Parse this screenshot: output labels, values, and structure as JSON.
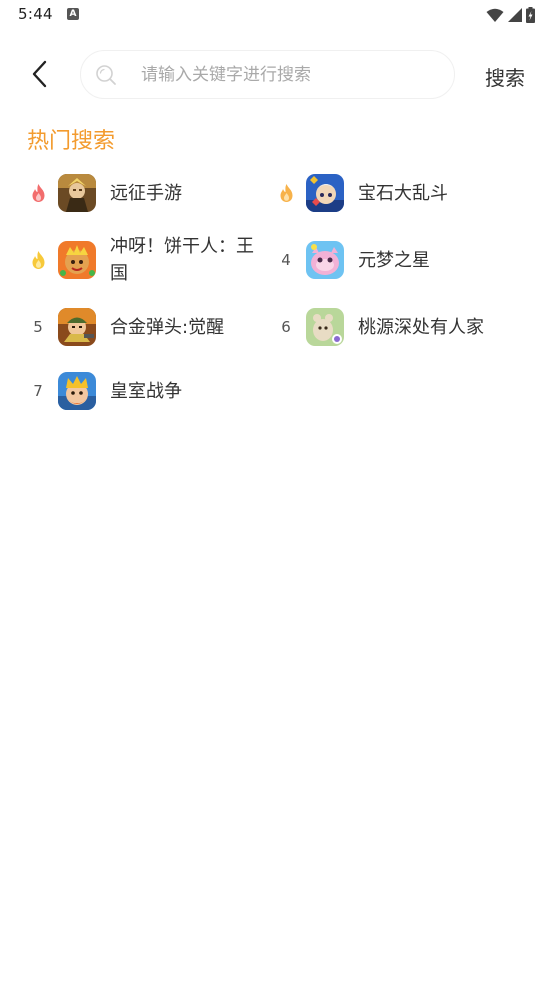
{
  "status_bar": {
    "time": "5:44",
    "notification_icon": "A"
  },
  "header": {
    "back_icon": "chevron-left-icon",
    "search_placeholder": "请输入关键字进行搜索",
    "search_value": "",
    "search_button_label": "搜索"
  },
  "hot_search": {
    "title": "热门搜索",
    "items": [
      {
        "rank": "1",
        "rank_icon": "flame-icon",
        "name": "远征手游",
        "flame_color": "#f26d6d"
      },
      {
        "rank": "2",
        "rank_icon": "flame-icon",
        "name": "宝石大乱斗",
        "flame_color": "#f7b24a"
      },
      {
        "rank": "3",
        "rank_icon": "flame-icon",
        "name": "冲呀！饼干人：王国",
        "flame_color": "#f7c93a"
      },
      {
        "rank": "4",
        "name": "元梦之星"
      },
      {
        "rank": "5",
        "name": "合金弹头:觉醒"
      },
      {
        "rank": "6",
        "name": "桃源深处有人家"
      },
      {
        "rank": "7",
        "name": "皇室战争"
      }
    ]
  }
}
